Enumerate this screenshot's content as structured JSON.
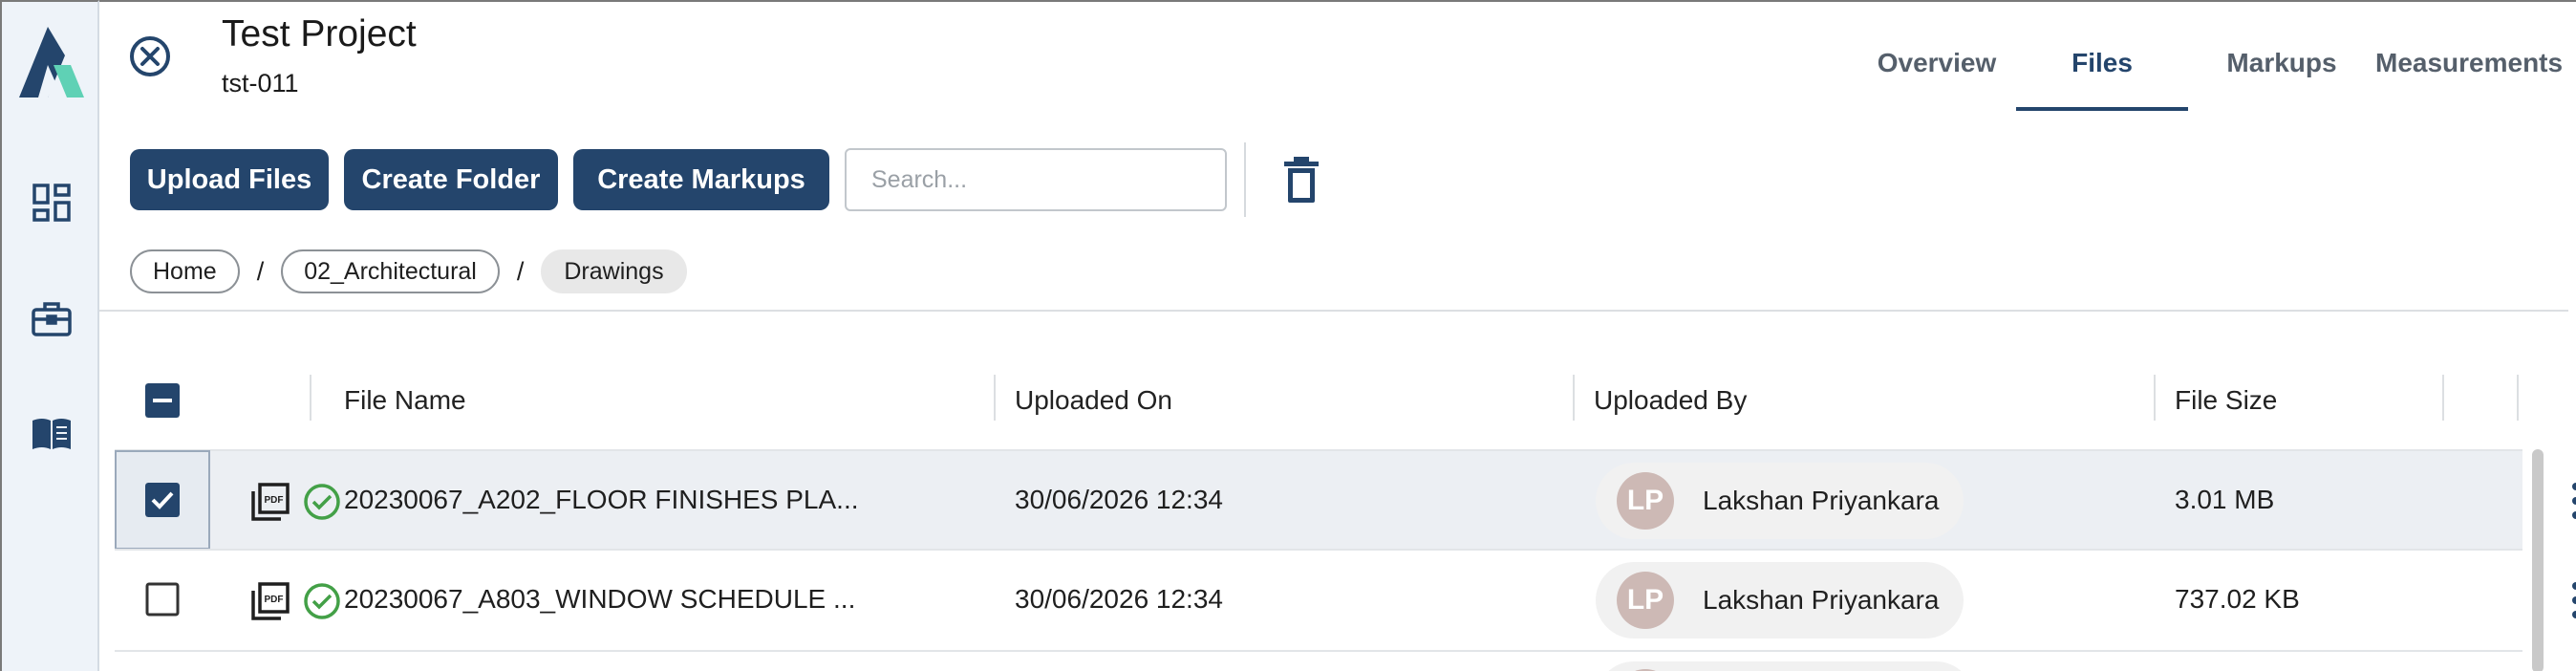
{
  "project": {
    "title": "Test Project",
    "code": "tst-011"
  },
  "tabs": [
    "Overview",
    "Files",
    "Markups",
    "Measurements"
  ],
  "active_tab": "Files",
  "toolbar": {
    "upload_label": "Upload Files",
    "folder_label": "Create Folder",
    "markups_label": "Create Markups",
    "search_placeholder": "Search..."
  },
  "breadcrumb": [
    "Home",
    "02_Architectural",
    "Drawings"
  ],
  "breadcrumb_separator": "/",
  "table": {
    "headers": [
      "File Name",
      "Uploaded On",
      "Uploaded By",
      "File Size"
    ],
    "rows": [
      {
        "selected": true,
        "file_name": "20230067_A202_FLOOR FINISHES PLA...",
        "uploaded_on": "30/06/2026 12:34",
        "initials": "LP",
        "uploaded_by": "Lakshan Priyankara",
        "file_size": "3.01 MB"
      },
      {
        "selected": false,
        "file_name": "20230067_A803_WINDOW SCHEDULE ...",
        "uploaded_on": "30/06/2026 12:34",
        "initials": "LP",
        "uploaded_by": "Lakshan Priyankara",
        "file_size": "737.02 KB"
      }
    ]
  },
  "icons": {
    "logo": "app-logo",
    "nav": [
      "dashboard-icon",
      "briefcase-icon",
      "book-icon"
    ],
    "close": "close-circle-icon",
    "trash": "trash-icon",
    "file_type": "pdf-stack-icon",
    "status": "check-circle-icon",
    "menu": "more-vertical-icon"
  },
  "colors": {
    "primary": "#24456c",
    "accent": "#5fd1b5",
    "success": "#43a047",
    "avatar": "#cdb9b5"
  }
}
